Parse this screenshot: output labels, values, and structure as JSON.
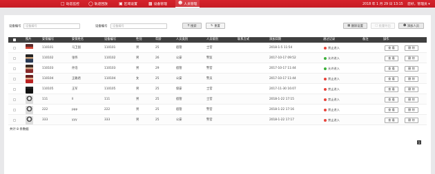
{
  "nav": {
    "items": [
      {
        "icon": "monitor-icon",
        "label": "动态监控",
        "active": false
      },
      {
        "icon": "visitor-icon",
        "label": "轨迹回放",
        "active": false
      },
      {
        "icon": "area-icon",
        "label": "区域设置",
        "active": false
      },
      {
        "icon": "device-icon",
        "label": "设备管理",
        "active": false
      },
      {
        "icon": "people-icon",
        "label": "人员管理",
        "active": true
      }
    ],
    "datetime": "2018 年 1 月 29 日 13:15",
    "user": "您好，管理员 ▾"
  },
  "filters": {
    "device_no_label": "设备编号",
    "device_no_placeholder": "设备编号",
    "device_id_label": "设备编号",
    "device_id_placeholder": "设备编号",
    "search_label": "搜索",
    "reset_label": "重置"
  },
  "actions": {
    "batch_delete": "删除设置",
    "batch_export": "批量导出",
    "add_person": "添加人员"
  },
  "table": {
    "headers": [
      "照片",
      "安保编号",
      "安保姓名",
      "设备编号",
      "性别",
      "年龄",
      "人员类别",
      "人员级别",
      "联系方式",
      "添加日期",
      "通过记录",
      "备注",
      "操作"
    ],
    "rows": [
      {
        "id": "110101",
        "name": "马卫国",
        "device": "110101",
        "gender": "男",
        "age": "25",
        "type": "宿管",
        "level": "士官",
        "contact": "",
        "date": "2018-1-5 11:54",
        "status": "禁止进入",
        "status_color": "#e8453c",
        "note": ""
      },
      {
        "id": "110102",
        "name": "张伟",
        "device": "110102",
        "gender": "男",
        "age": "26",
        "type": "公安",
        "level": "警监",
        "contact": "",
        "date": "2017-10-17 09:52",
        "status": "允许进入",
        "status_color": "#3db23d",
        "note": ""
      },
      {
        "id": "110103",
        "name": "孙浩",
        "device": "110103",
        "gender": "男",
        "age": "29",
        "type": "宿管",
        "level": "警官",
        "contact": "",
        "date": "2017-10-17 11:44",
        "status": "允许进入",
        "status_color": "#3db23d",
        "note": ""
      },
      {
        "id": "110104",
        "name": "王雅君",
        "device": "110104",
        "gender": "女",
        "age": "25",
        "type": "公安",
        "level": "警员",
        "contact": "",
        "date": "2017-10-17 11:44",
        "status": "禁止进入",
        "status_color": "#e8453c",
        "note": ""
      },
      {
        "id": "110105",
        "name": "王军",
        "device": "110105",
        "gender": "男",
        "age": "25",
        "type": "保安",
        "level": "士官",
        "contact": "",
        "date": "2017-11-30 16:07",
        "status": "禁止进入",
        "status_color": "#e8453c",
        "note": ""
      },
      {
        "id": "111",
        "name": "ll",
        "device": "111",
        "gender": "男",
        "age": "25",
        "type": "宿管",
        "level": "士官",
        "contact": "",
        "date": "2018-1-22 17:15",
        "status": "禁止进入",
        "status_color": "#e8453c",
        "note": ""
      },
      {
        "id": "222",
        "name": "ppp",
        "device": "222",
        "gender": "男",
        "age": "25",
        "type": "宿管",
        "level": "警官",
        "contact": "",
        "date": "2018-1-22 17:16",
        "status": "禁止进入",
        "status_color": "#e8453c",
        "note": ""
      },
      {
        "id": "333",
        "name": "yyy",
        "device": "333",
        "gender": "男",
        "age": "25",
        "type": "公安",
        "level": "警官",
        "contact": "",
        "date": "2018-1-22 17:17",
        "status": "禁止进入",
        "status_color": "#e8453c",
        "note": ""
      }
    ],
    "row_actions": {
      "view": "查 看",
      "delete": "删 除"
    }
  },
  "footer": {
    "total": "共计 8 条数据",
    "page": "1"
  },
  "colors": {
    "brand": "#d6232c",
    "header_bg": "#3f3f3f",
    "allowed": "#3db23d",
    "denied": "#e8453c"
  }
}
